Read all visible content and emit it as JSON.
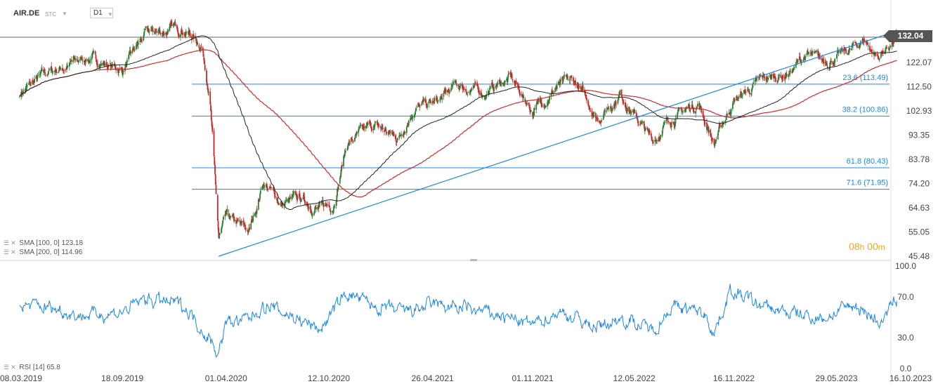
{
  "header": {
    "symbol": "AIR.DE",
    "market": "STC",
    "timeframe": "D1"
  },
  "last_price_label": "132.04",
  "countdown": {
    "hours": "08",
    "hours_unit": "h",
    "minutes": "00",
    "minutes_unit": "m"
  },
  "indicators": {
    "sma100": {
      "label": "SMA [100, 0] 123.18",
      "color": "#222222"
    },
    "sma200": {
      "label": "SMA [200, 0] 114.96",
      "color": "#d42a2a"
    },
    "rsi": {
      "label": "RSI [14] 65.8",
      "color": "#1e88e5"
    }
  },
  "colors": {
    "up": "#2e7d32",
    "down": "#c62828",
    "fib": "#1e88e5",
    "trend": "#1e88e5",
    "price_line": "#666666"
  },
  "chart_data": {
    "type": "candlestick",
    "price_axis": {
      "ticks": [
        132.04,
        122.07,
        112.5,
        102.93,
        93.35,
        83.78,
        74.2,
        64.63,
        55.05,
        45.48
      ],
      "labels": [
        "132.04",
        "122.07",
        "112.50",
        "102.93",
        "93.35",
        "83.78",
        "74.20",
        "64.63",
        "55.05",
        "45.48"
      ],
      "ylim": [
        45.48,
        136
      ]
    },
    "rsi_axis": {
      "ticks": [
        100,
        70,
        30,
        0
      ],
      "labels": [
        "100.0",
        "70.0",
        "30.0",
        "0.0"
      ]
    },
    "x_labels": [
      "08.03.2019",
      "18.09.2019",
      "01.04.2020",
      "12.10.2020",
      "26.04.2021",
      "01.11.2021",
      "12.05.2022",
      "16.11.2022",
      "29.05.2023",
      "16.10.2023"
    ],
    "fib_levels": [
      {
        "label": "23.6 (113.49)",
        "value": 113.49
      },
      {
        "label": "38.2 (100.86)",
        "value": 100.86
      },
      {
        "label": "61.8 (80.43)",
        "value": 80.43
      },
      {
        "label": "71.6 (71.95)",
        "value": 71.95
      }
    ],
    "last_price": 132.04,
    "price_anchors": [
      [
        "2019-03-08",
        110
      ],
      [
        "2019-05-01",
        118
      ],
      [
        "2019-07-15",
        124
      ],
      [
        "2019-09-18",
        119
      ],
      [
        "2019-11-01",
        133
      ],
      [
        "2020-01-10",
        136
      ],
      [
        "2020-02-15",
        129
      ],
      [
        "2020-03-01",
        110
      ],
      [
        "2020-03-18",
        52
      ],
      [
        "2020-04-01",
        60
      ],
      [
        "2020-05-15",
        55
      ],
      [
        "2020-06-10",
        75
      ],
      [
        "2020-07-15",
        66
      ],
      [
        "2020-08-20",
        68
      ],
      [
        "2020-09-25",
        64
      ],
      [
        "2020-10-20",
        66
      ],
      [
        "2020-11-15",
        90
      ],
      [
        "2021-01-05",
        97
      ],
      [
        "2021-02-20",
        92
      ],
      [
        "2021-03-20",
        104
      ],
      [
        "2021-05-05",
        106
      ],
      [
        "2021-06-10",
        113
      ],
      [
        "2021-08-01",
        110
      ],
      [
        "2021-09-20",
        116
      ],
      [
        "2021-11-01",
        103
      ],
      [
        "2021-12-20",
        113
      ],
      [
        "2022-01-20",
        114
      ],
      [
        "2022-03-05",
        100
      ],
      [
        "2022-04-15",
        110
      ],
      [
        "2022-06-15",
        91
      ],
      [
        "2022-07-20",
        100
      ],
      [
        "2022-09-10",
        106
      ],
      [
        "2022-10-10",
        90
      ],
      [
        "2022-11-15",
        107
      ],
      [
        "2023-01-10",
        115
      ],
      [
        "2023-03-01",
        118
      ],
      [
        "2023-04-01",
        125
      ],
      [
        "2023-05-01",
        122
      ],
      [
        "2023-06-20",
        126
      ],
      [
        "2023-07-20",
        131
      ],
      [
        "2023-08-15",
        124
      ],
      [
        "2023-09-20",
        132.04
      ]
    ],
    "trendline": {
      "from": [
        "2020-03-18",
        45.48
      ],
      "to": [
        "2023-09-20",
        134.5
      ]
    },
    "rsi_anchors": [
      [
        "2019-03-08",
        62
      ],
      [
        "2019-05-01",
        60
      ],
      [
        "2019-07-01",
        52
      ],
      [
        "2019-09-18",
        55
      ],
      [
        "2019-11-01",
        68
      ],
      [
        "2020-01-10",
        62
      ],
      [
        "2020-02-15",
        40
      ],
      [
        "2020-03-18",
        15
      ],
      [
        "2020-04-01",
        45
      ],
      [
        "2020-05-15",
        48
      ],
      [
        "2020-06-10",
        62
      ],
      [
        "2020-08-01",
        52
      ],
      [
        "2020-09-25",
        38
      ],
      [
        "2020-11-15",
        74
      ],
      [
        "2021-01-05",
        60
      ],
      [
        "2021-03-01",
        55
      ],
      [
        "2021-05-01",
        62
      ],
      [
        "2021-07-01",
        58
      ],
      [
        "2021-09-01",
        52
      ],
      [
        "2021-11-01",
        42
      ],
      [
        "2021-12-20",
        56
      ],
      [
        "2022-03-05",
        40
      ],
      [
        "2022-04-20",
        50
      ],
      [
        "2022-06-15",
        37
      ],
      [
        "2022-07-20",
        60
      ],
      [
        "2022-09-20",
        55
      ],
      [
        "2022-10-10",
        36
      ],
      [
        "2022-11-10",
        76
      ],
      [
        "2023-01-10",
        60
      ],
      [
        "2023-03-01",
        54
      ],
      [
        "2023-05-01",
        49
      ],
      [
        "2023-07-01",
        62
      ],
      [
        "2023-08-20",
        46
      ],
      [
        "2023-09-20",
        65.8
      ]
    ]
  }
}
